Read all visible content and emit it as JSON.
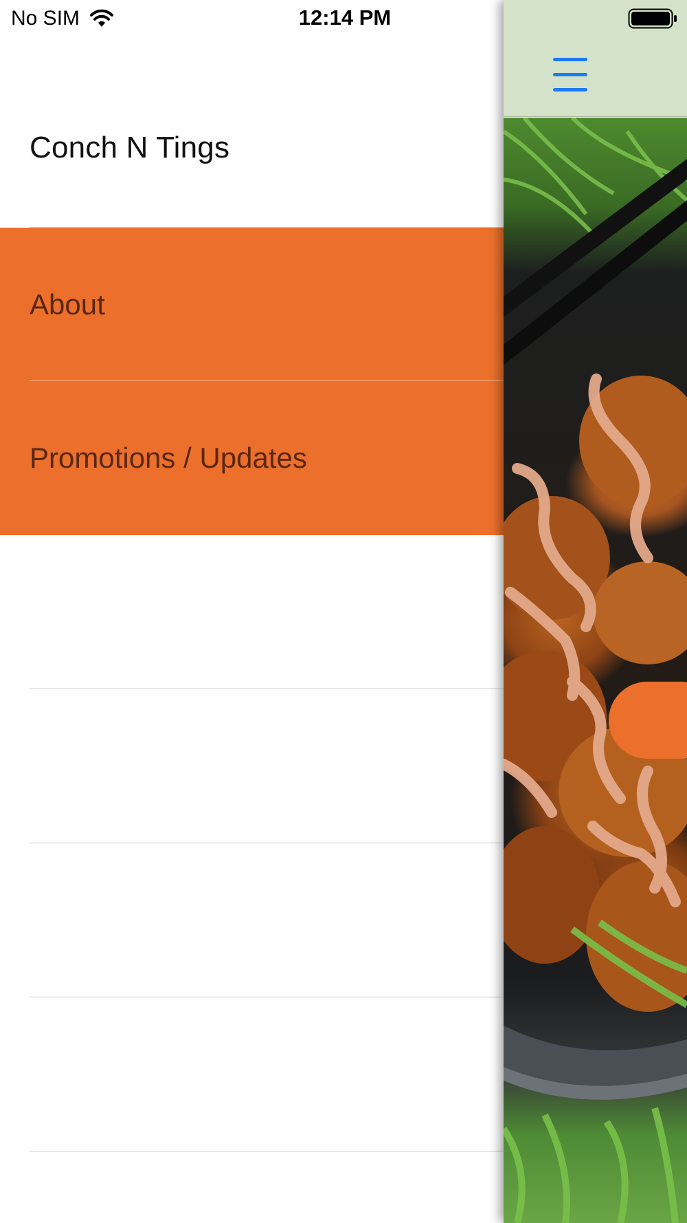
{
  "status_bar": {
    "carrier": "No SIM",
    "time": "12:14 PM",
    "wifi_icon": "wifi-icon",
    "battery_icon": "battery-icon"
  },
  "menu": {
    "title": "Conch N Tings",
    "items": [
      {
        "label": "About",
        "active": true
      },
      {
        "label": "Promotions / Updates",
        "active": true
      },
      {
        "label": "",
        "active": false
      },
      {
        "label": "",
        "active": false
      },
      {
        "label": "",
        "active": false
      },
      {
        "label": "",
        "active": false
      }
    ]
  },
  "main": {
    "menu_icon": "hamburger-menu-icon",
    "image_subject": "conch fritters with sauce on grass",
    "accent_color": "#ec702c",
    "nav_background": "#d4e2c9",
    "icon_color": "#1a7cf5"
  }
}
